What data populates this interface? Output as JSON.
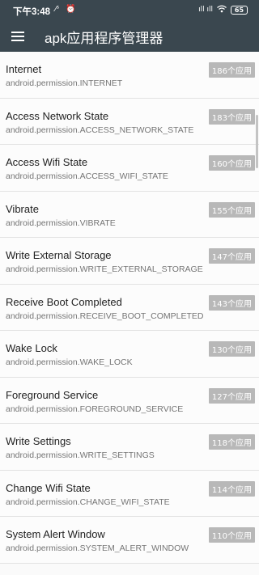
{
  "status_bar": {
    "time": "下午3:48",
    "signal": "ıll ıll",
    "battery": "65"
  },
  "app_bar": {
    "title": "apk应用程序管理器",
    "menu_icon": "hamburger-menu-icon"
  },
  "permissions": [
    {
      "name": "Internet",
      "permission": "android.permission.INTERNET",
      "count": "186个应用"
    },
    {
      "name": "Access Network State",
      "permission": "android.permission.ACCESS_NETWORK_STATE",
      "count": "183个应用"
    },
    {
      "name": "Access Wifi State",
      "permission": "android.permission.ACCESS_WIFI_STATE",
      "count": "160个应用"
    },
    {
      "name": "Vibrate",
      "permission": "android.permission.VIBRATE",
      "count": "155个应用"
    },
    {
      "name": "Write External Storage",
      "permission": "android.permission.WRITE_EXTERNAL_STORAGE",
      "count": "147个应用"
    },
    {
      "name": "Receive Boot Completed",
      "permission": "android.permission.RECEIVE_BOOT_COMPLETED",
      "count": "143个应用"
    },
    {
      "name": "Wake Lock",
      "permission": "android.permission.WAKE_LOCK",
      "count": "130个应用"
    },
    {
      "name": "Foreground Service",
      "permission": "android.permission.FOREGROUND_SERVICE",
      "count": "127个应用"
    },
    {
      "name": "Write Settings",
      "permission": "android.permission.WRITE_SETTINGS",
      "count": "118个应用"
    },
    {
      "name": "Change Wifi State",
      "permission": "android.permission.CHANGE_WIFI_STATE",
      "count": "114个应用"
    },
    {
      "name": "System Alert Window",
      "permission": "android.permission.SYSTEM_ALERT_WINDOW",
      "count": "110个应用"
    }
  ],
  "colors": {
    "toolbar": "#3a474f",
    "badge": "#b8b8b8",
    "divider": "#e2e2e2"
  }
}
